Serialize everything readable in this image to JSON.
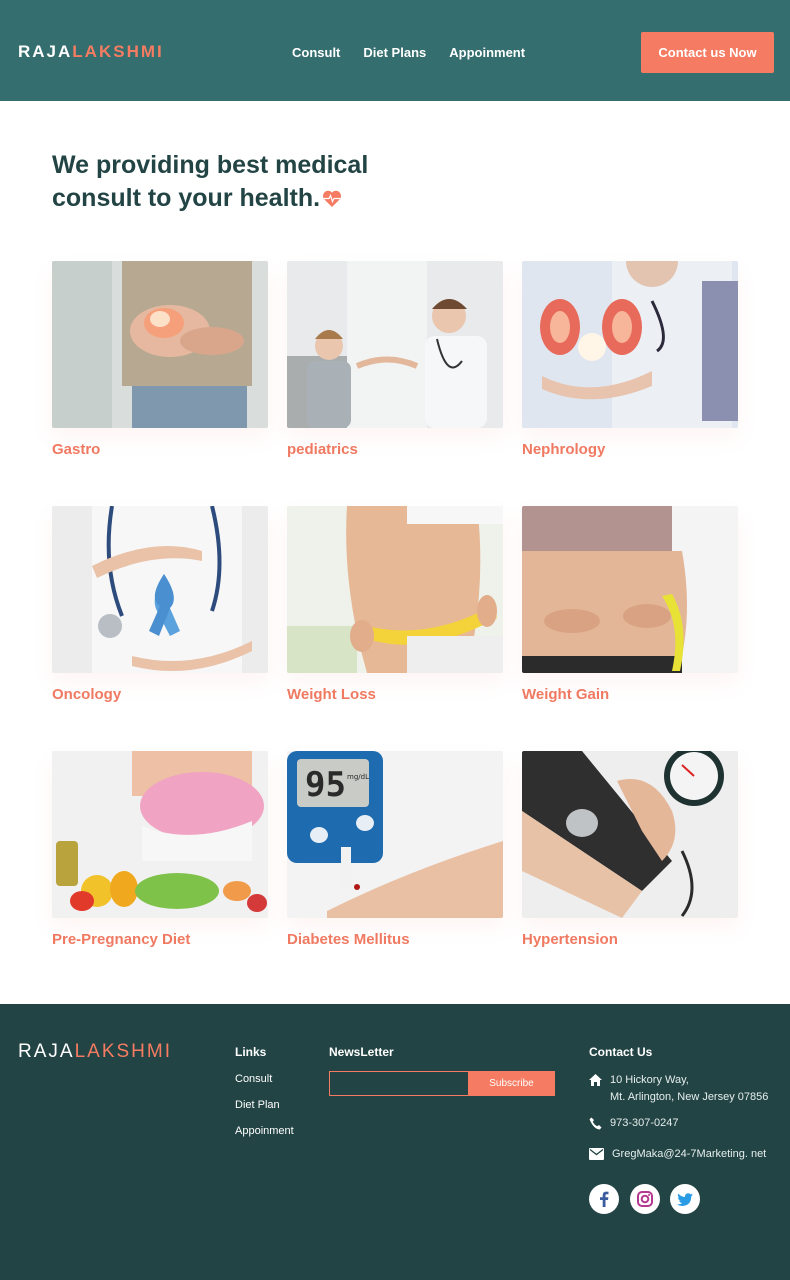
{
  "header": {
    "logo_part1": "RAJA",
    "logo_part2": "LAKSHMI",
    "nav": [
      "Consult",
      "Diet Plans",
      "Appoinment"
    ],
    "cta_label": "Contact us Now"
  },
  "hero": {
    "line1": "We providing best medical",
    "line2": "consult to your health."
  },
  "cards": [
    {
      "label": "Gastro"
    },
    {
      "label": "pediatrics"
    },
    {
      "label": "Nephrology"
    },
    {
      "label": "Oncology"
    },
    {
      "label": "Weight Loss"
    },
    {
      "label": "Weight Gain"
    },
    {
      "label": "Pre-Pregnancy Diet"
    },
    {
      "label": "Diabetes Mellitus"
    },
    {
      "label": "Hypertension"
    }
  ],
  "glucose_reading": "95",
  "glucose_unit": "mg/dL",
  "footer": {
    "logo_part1": "RAJA",
    "logo_part2": "LAKSHMI",
    "links_heading": "Links",
    "links": [
      "Consult",
      "Diet Plan",
      "Appoinment"
    ],
    "newsletter_heading": "NewsLetter",
    "subscribe_label": "Subscribe",
    "contact_heading": "Contact Us",
    "address_line1": "10 Hickory Way,",
    "address_line2": "Mt. Arlington, New Jersey 07856",
    "phone": "973-307-0247",
    "email": "GregMaka@24-7Marketing. net"
  },
  "colors": {
    "header_bg": "#346e6e",
    "footer_bg": "#234444",
    "accent": "#f57c62",
    "title_text": "#234444"
  },
  "icons": [
    "heart-pulse-icon",
    "home-icon",
    "phone-icon",
    "mail-icon",
    "facebook-icon",
    "instagram-icon",
    "twitter-icon"
  ]
}
